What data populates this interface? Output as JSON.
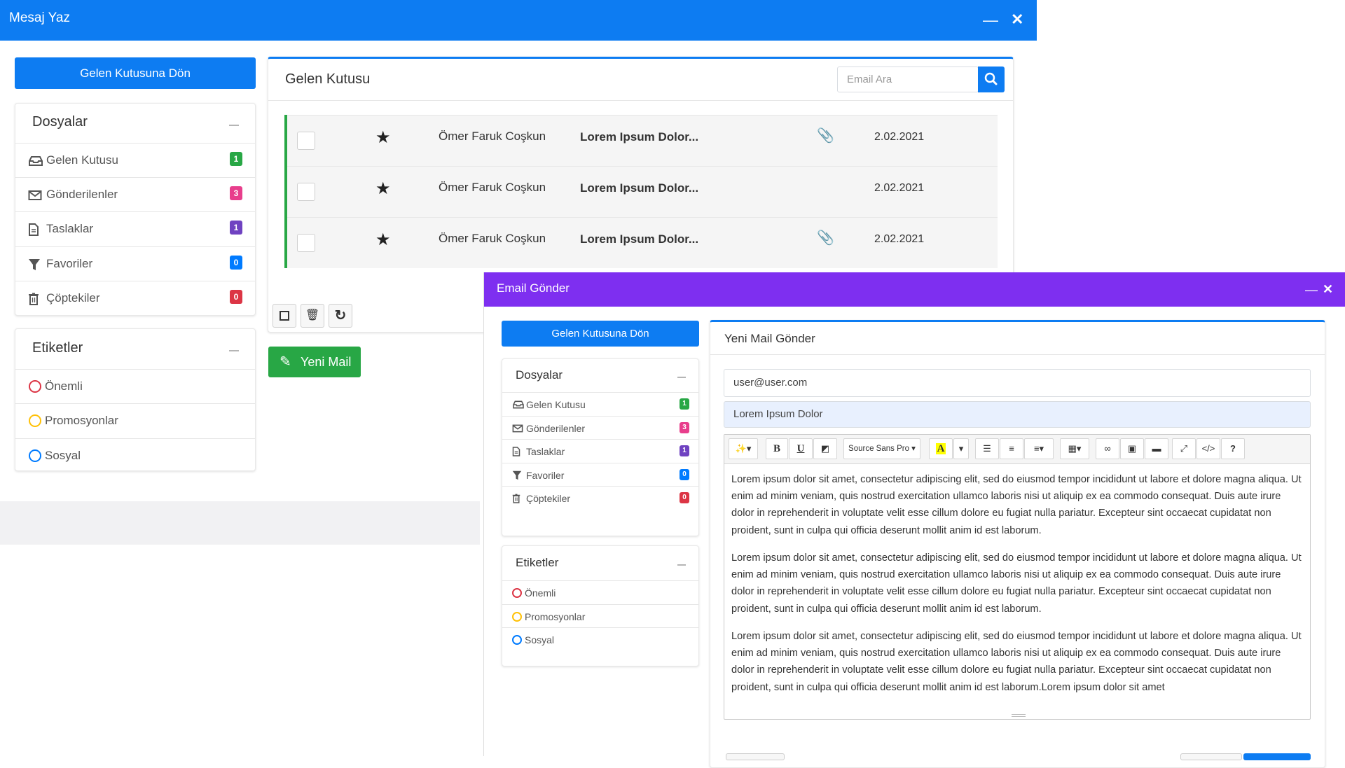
{
  "win1": {
    "title": "Mesaj Yaz",
    "back_button": "Gelen Kutusuna Dön",
    "folders_title": "Dosyalar",
    "folders": [
      {
        "label": "Gelen Kutusu",
        "count": "1",
        "icon": "inbox-icon",
        "color": "#28a745"
      },
      {
        "label": "Gönderilenler",
        "count": "3",
        "icon": "envelope-icon",
        "color": "#e83e8c"
      },
      {
        "label": "Taslaklar",
        "count": "1",
        "icon": "file-icon",
        "color": "#6f42c1"
      },
      {
        "label": "Favoriler",
        "count": "0",
        "icon": "filter-icon",
        "color": "#007bff"
      },
      {
        "label": "Çöptekiler",
        "count": "0",
        "icon": "trash-icon",
        "color": "#dc3545"
      }
    ],
    "labels_title": "Etiketler",
    "labels": [
      {
        "label": "Önemli",
        "color": "#dc3545"
      },
      {
        "label": "Promosyonlar",
        "color": "#ffc107"
      },
      {
        "label": "Sosyal",
        "color": "#007bff"
      }
    ],
    "inbox_title": "Gelen Kutusu",
    "search_placeholder": "Email Ara",
    "mails": [
      {
        "sender": "Ömer Faruk Coşkun",
        "subject": "Lorem Ipsum Dolor...",
        "attachment": true,
        "date": "2.02.2021"
      },
      {
        "sender": "Ömer Faruk Coşkun",
        "subject": "Lorem Ipsum Dolor...",
        "attachment": false,
        "date": "2.02.2021"
      },
      {
        "sender": "Ömer Faruk Coşkun",
        "subject": "Lorem Ipsum Dolor...",
        "attachment": true,
        "date": "2.02.2021"
      }
    ],
    "new_mail": "Yeni Mail"
  },
  "win2": {
    "title": "Email Gönder",
    "back_button": "Gelen Kutusuna Dön",
    "folders_title": "Dosyalar",
    "labels_title": "Etiketler",
    "compose_title": "Yeni Mail Gönder",
    "to": "user@user.com",
    "subject": "Lorem Ipsum Dolor",
    "font_name": "Source Sans Pro",
    "body": [
      "Lorem ipsum dolor sit amet, consectetur adipiscing elit, sed do eiusmod tempor incididunt ut labore et dolore magna aliqua. Ut enim ad minim veniam, quis nostrud exercitation ullamco laboris nisi ut aliquip ex ea commodo consequat. Duis aute irure dolor in reprehenderit in voluptate velit esse cillum dolore eu fugiat nulla pariatur. Excepteur sint occaecat cupidatat non proident, sunt in culpa qui officia deserunt mollit anim id est laborum.",
      "Lorem ipsum dolor sit amet, consectetur adipiscing elit, sed do eiusmod tempor incididunt ut labore et dolore magna aliqua. Ut enim ad minim veniam, quis nostrud exercitation ullamco laboris nisi ut aliquip ex ea commodo consequat. Duis aute irure dolor in reprehenderit in voluptate velit esse cillum dolore eu fugiat nulla pariatur. Excepteur sint occaecat cupidatat non proident, sunt in culpa qui officia deserunt mollit anim id est laborum.",
      "Lorem ipsum dolor sit amet, consectetur adipiscing elit, sed do eiusmod tempor incididunt ut labore et dolore magna aliqua. Ut enim ad minim veniam, quis nostrud exercitation ullamco laboris nisi ut aliquip ex ea commodo consequat. Duis aute irure dolor in reprehenderit in voluptate velit esse cillum dolore eu fugiat nulla pariatur. Excepteur sint occaecat cupidatat non proident, sunt in culpa qui officia deserunt mollit anim id est laborum.Lorem ipsum dolor sit amet"
    ]
  },
  "colors": {
    "blue": "#0d7cf2",
    "purple": "#7e2ff0",
    "green": "#28a745"
  }
}
